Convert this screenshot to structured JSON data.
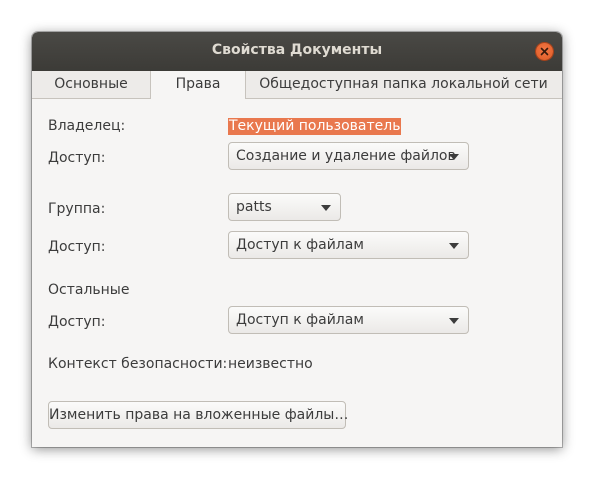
{
  "window": {
    "title": "Свойства Документы"
  },
  "tabs": [
    {
      "label": "Основные",
      "active": false
    },
    {
      "label": "Права",
      "active": true
    },
    {
      "label": "Общедоступная папка локальной сети",
      "active": false
    }
  ],
  "owner": {
    "label": "Владелец:",
    "value": "Текущий пользователь",
    "access_label": "Доступ:",
    "access_value": "Создание и удаление файлов"
  },
  "group": {
    "label": "Группа:",
    "value": "patts",
    "access_label": "Доступ:",
    "access_value": "Доступ к файлам"
  },
  "others": {
    "label": "Остальные",
    "access_label": "Доступ:",
    "access_value": "Доступ к файлам"
  },
  "security": {
    "label": "Контекст безопасности:",
    "value": "неизвестно"
  },
  "apply_button": {
    "label": "Изменить права на вложенные файлы…"
  },
  "colors": {
    "titlebar": "#3c3b37",
    "close_button": "#e25a23",
    "selection_highlight": "#e9784e",
    "window_bg": "#f6f5f4"
  }
}
